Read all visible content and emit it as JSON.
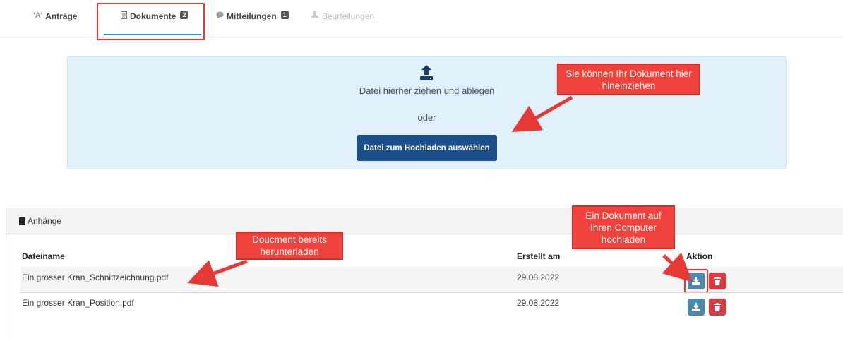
{
  "tabs": [
    {
      "icon": "'A'",
      "label": "Anträge",
      "badge": ""
    },
    {
      "icon": "doc-icon",
      "label": "Dokumente",
      "badge": "2"
    },
    {
      "icon": "chat-icon",
      "label": "Mitteilungen",
      "badge": "1"
    },
    {
      "icon": "review-icon",
      "label": "Beurteilungen",
      "badge": ""
    }
  ],
  "upload": {
    "drop_text": "Datei hierher ziehen und ablegen",
    "or_text": "oder",
    "button_label": "Datei zum Hochladen auswählen"
  },
  "attachments": {
    "title": "Anhänge",
    "columns": [
      "Dateiname",
      "Erstellt am",
      "Aktion"
    ],
    "rows": [
      {
        "filename": "Ein grosser Kran_Schnittzeichnung.pdf",
        "created": "29.08.2022"
      },
      {
        "filename": "Ein grosser Kran_Position.pdf",
        "created": "29.08.2022"
      }
    ]
  },
  "callouts": {
    "drag_hint": "Sie können Ihr Dokument hier hineinziehen",
    "existing_doc": "Doucment bereits herunterladen",
    "download_hint": "Ein Dokument auf Ihren Computer hochladen"
  },
  "colors": {
    "accent": "#3b87c9",
    "primary_button": "#1c4f8a",
    "download_button": "#4a89b0",
    "delete_button": "#d9393f",
    "callout": "#f0423d"
  }
}
